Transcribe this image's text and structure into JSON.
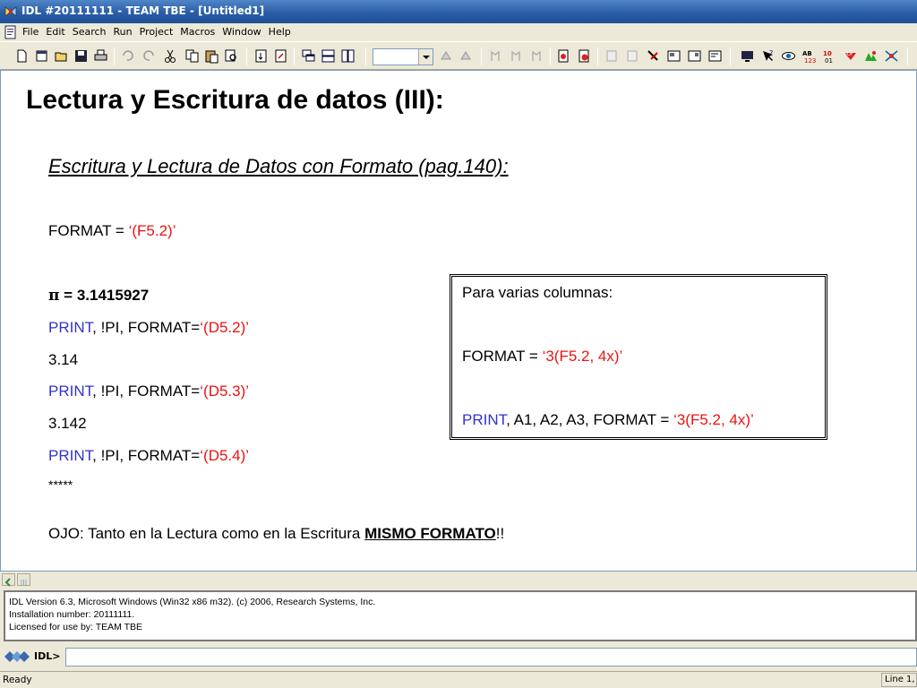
{
  "window": {
    "title": "IDL #20111111 - TEAM TBE - [Untitled1]"
  },
  "menu": [
    "File",
    "Edit",
    "Search",
    "Run",
    "Project",
    "Macros",
    "Window",
    "Help"
  ],
  "toolbar": {
    "icons": [
      "new-file-icon",
      "new-project-icon",
      "open-icon",
      "save-icon",
      "print-icon",
      "undo-icon",
      "redo-icon",
      "cut-icon",
      "copy-icon",
      "paste-icon",
      "find-icon",
      "compile-icon",
      "run-icon",
      "cascade-icon",
      "tile-horizontal-icon",
      "tile-vertical-icon",
      "step-into-icon",
      "step-over-icon",
      "breakpoint-icon",
      "clear-breakpoint-icon",
      "watch-icon",
      "reset-icon",
      "stop-icon",
      "trace-icon",
      "edit-icon",
      "build-icon",
      "export-icon",
      "display-icon",
      "help-icon",
      "eye-icon",
      "abc-icon",
      "numbers-icon",
      "pdf-icon",
      "tree-icon",
      "network-icon"
    ],
    "combo_value": ""
  },
  "slide": {
    "title": "Lectura y Escritura de datos (III):",
    "subtitle": "Escritura y Lectura de Datos con Formato (pag.140):",
    "format_label": "FORMAT = ",
    "format_value": "‘(F5.2)’",
    "pi_symbol": "π",
    "pi_value": " = 3.1415927",
    "print_kw": "PRINT",
    "print_args": ", !PI, FORMAT=",
    "fmt1": "‘(D5.2)’",
    "out1": "3.14",
    "fmt2": "‘(D5.3)’",
    "out2": "3.142",
    "fmt3": "‘(D5.4)’",
    "out3": "*****",
    "note_prefix": "OJO: Tanto en la Lectura como en la Escritura ",
    "note_emph": "MISMO FORMATO",
    "note_suffix": "!!",
    "box": {
      "heading": "Para varias columnas:",
      "format_label": "FORMAT = ",
      "format_value": "‘3(F5.2, 4x)’",
      "print_kw": "PRINT",
      "print_args": ", A1, A2, A3, FORMAT = ",
      "print_fmt": "‘3(F5.2, 4x)’"
    }
  },
  "output": [
    "IDL Version 6.3, Microsoft Windows (Win32 x86 m32). (c) 2006, Research Systems, Inc.",
    "Installation number: 20111111.",
    "Licensed for use by: TEAM TBE"
  ],
  "command": {
    "prompt": "IDL>",
    "value": ""
  },
  "status": {
    "text": "Ready",
    "position": "Line 1, C"
  },
  "colors": {
    "keyword": "#3333cc",
    "string": "#ee1111",
    "titlebar": "#2a5da8"
  }
}
